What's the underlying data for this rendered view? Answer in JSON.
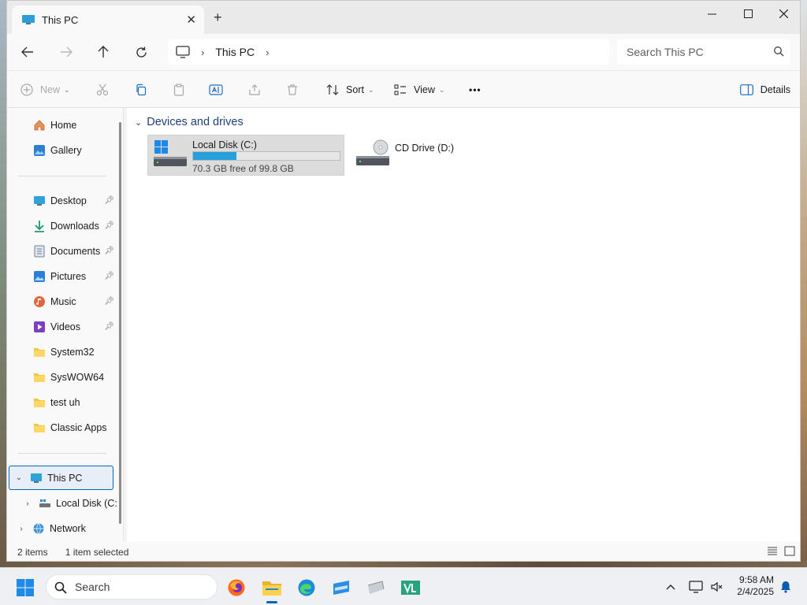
{
  "window": {
    "tab_title": "This PC",
    "tab_close": "✕",
    "new_tab": "+"
  },
  "address": {
    "breadcrumbs": [
      "This PC"
    ],
    "search_placeholder": "Search This PC"
  },
  "commands": {
    "new": "New",
    "sort": "Sort",
    "view": "View",
    "more": "•••",
    "details": "Details"
  },
  "sidebar": {
    "items": [
      {
        "label": "Home",
        "icon": "home-icon"
      },
      {
        "label": "Gallery",
        "icon": "gallery-icon"
      },
      {
        "label": "Desktop",
        "icon": "desktop-icon",
        "pinned": true
      },
      {
        "label": "Downloads",
        "icon": "downloads-icon",
        "pinned": true
      },
      {
        "label": "Documents",
        "icon": "documents-icon",
        "pinned": true
      },
      {
        "label": "Pictures",
        "icon": "pictures-icon",
        "pinned": true
      },
      {
        "label": "Music",
        "icon": "music-icon",
        "pinned": true
      },
      {
        "label": "Videos",
        "icon": "videos-icon",
        "pinned": true
      },
      {
        "label": "System32",
        "icon": "folder-icon"
      },
      {
        "label": "SysWOW64",
        "icon": "folder-icon"
      },
      {
        "label": "test uh",
        "icon": "folder-icon"
      },
      {
        "label": "Classic Apps",
        "icon": "folder-icon"
      },
      {
        "label": "This PC",
        "icon": "this-pc-icon",
        "selected": true
      },
      {
        "label": "Local Disk (C:",
        "icon": "drive-icon"
      },
      {
        "label": "Network",
        "icon": "network-icon"
      }
    ]
  },
  "content": {
    "group_title": "Devices and drives",
    "drives": [
      {
        "name": "Local Disk (C:)",
        "free_text": "70.3 GB free of 99.8 GB",
        "used_fraction": 0.296,
        "selected": true
      },
      {
        "name": "CD Drive (D:)"
      }
    ]
  },
  "status": {
    "items_count": "2 items",
    "selected": "1 item selected"
  },
  "taskbar": {
    "search_label": "Search",
    "time": "9:58 AM",
    "date": "2/4/2025"
  },
  "colors": {
    "accent": "#0067c0",
    "drive_bar": "#26a0da",
    "folder": "#f4c542"
  }
}
